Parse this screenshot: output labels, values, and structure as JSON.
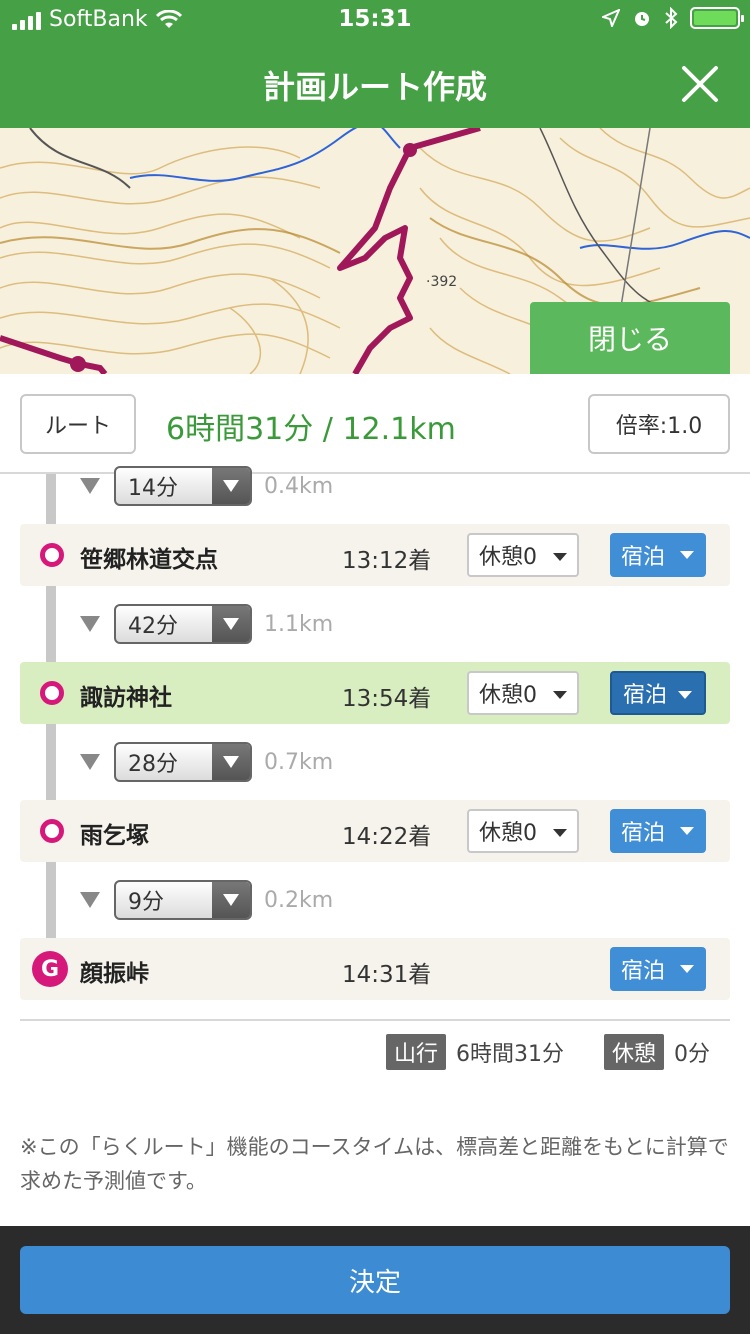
{
  "status_bar": {
    "carrier": "SoftBank",
    "time": "15:31",
    "battery_color": "#6edc5a"
  },
  "header": {
    "title": "計画ルート作成",
    "close_icon": "close-icon"
  },
  "map": {
    "elevation_label": "·392",
    "close_button": "閉じる"
  },
  "summary": {
    "route_button": "ルート",
    "time_distance": "6時間31分 / 12.1km",
    "rate_button": "倍率:1.0"
  },
  "segments": [
    {
      "duration": "14分",
      "distance": "0.4km"
    },
    {
      "duration": "42分",
      "distance": "1.1km"
    },
    {
      "duration": "28分",
      "distance": "0.7km"
    },
    {
      "duration": "9分",
      "distance": "0.2km"
    }
  ],
  "waypoints": [
    {
      "name": "笹郷林道交点",
      "arrival": "13:12着",
      "rest": "休憩0",
      "stay": "宿泊"
    },
    {
      "name": "諏訪神社",
      "arrival": "13:54着",
      "rest": "休憩0",
      "stay": "宿泊"
    },
    {
      "name": "雨乞塚",
      "arrival": "14:22着",
      "rest": "休憩0",
      "stay": "宿泊"
    },
    {
      "name": "顔振峠",
      "arrival": "14:31着",
      "stay": "宿泊",
      "marker": "G"
    }
  ],
  "totals": {
    "walk_label": "山行",
    "walk_value": "6時間31分",
    "rest_label": "休憩",
    "rest_value": "0分"
  },
  "note": "※この「らくルート」機能のコースタイムは、標高差と距離をもとに計算で求めた予測値です。",
  "footer": {
    "decide_button": "決定"
  },
  "colors": {
    "header_green": "#46a046",
    "route_magenta": "#d6187b",
    "accent_blue": "#3d8bd2",
    "highlight_row": "#d8edc0"
  }
}
